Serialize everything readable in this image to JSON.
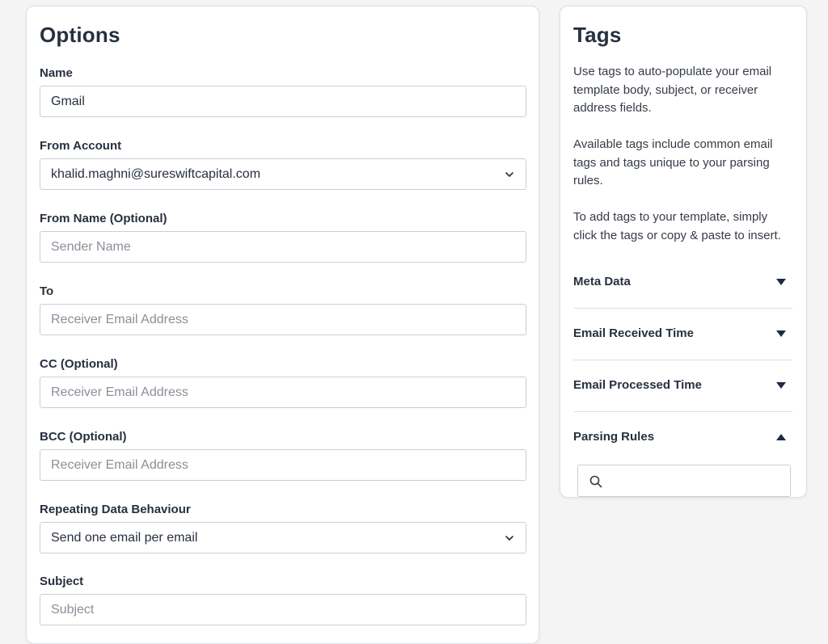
{
  "options": {
    "title": "Options",
    "fields": [
      {
        "label": "Name",
        "value": "Gmail",
        "placeholder": ""
      },
      {
        "label": "From Account",
        "value": "khalid.maghni@sureswiftcapital.com",
        "type": "select"
      },
      {
        "label": "From Name (Optional)",
        "value": "",
        "placeholder": "Sender Name"
      },
      {
        "label": "To",
        "value": "",
        "placeholder": "Receiver Email Address"
      },
      {
        "label": "CC (Optional)",
        "value": "",
        "placeholder": "Receiver Email Address"
      },
      {
        "label": "BCC (Optional)",
        "value": "",
        "placeholder": "Receiver Email Address"
      },
      {
        "label": "Repeating Data Behaviour",
        "value": "Send one email per email",
        "type": "select"
      },
      {
        "label": "Subject",
        "value": "",
        "placeholder": "Subject"
      }
    ]
  },
  "tags": {
    "title": "Tags",
    "descriptions": [
      "Use tags to auto-populate your email template body, subject, or receiver address fields.",
      "Available tags include common email tags and tags unique to your parsing rules.",
      "To add tags to your template, simply click the tags or copy & paste to insert."
    ],
    "sections": [
      {
        "label": "Meta Data",
        "caret": "caret-down-icon"
      },
      {
        "label": "Email Received Time",
        "caret": "caret-down-icon"
      },
      {
        "label": "Email Processed Time",
        "caret": "caret-down-icon"
      },
      {
        "label": "Parsing Rules",
        "caret": "caret-up-icon"
      }
    ],
    "search_icon": "search-icon"
  },
  "colors": {
    "text": "#27303f",
    "placeholder": "#8a8f98",
    "border": "#c9ced6",
    "page_bg": "#f4f4f5",
    "card_bg": "#ffffff"
  }
}
